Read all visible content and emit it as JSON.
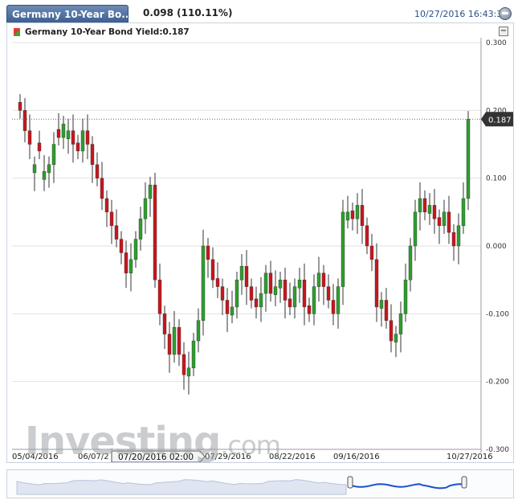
{
  "header": {
    "tab_title": "Germany 10-Year Bo...",
    "price_change": "0.098 (110.11%)",
    "datetime": "10/27/2016 16:43:38"
  },
  "legend": {
    "label": "Germany 10-Year Bond Yield:0.187"
  },
  "watermark": {
    "main": "Investing",
    "suffix": ".com"
  },
  "cursor_label": "07/20/2016 02:00",
  "colors": {
    "up": "#2e9e2e",
    "down": "#c8161d",
    "grid": "#e2e2e2",
    "accent": "#3e5f91"
  },
  "chart_data": {
    "type": "candlestick",
    "title": "Germany 10-Year Bond Yield",
    "current_value": 0.187,
    "current_label": "0.187",
    "ylim": [
      -0.3,
      0.3
    ],
    "y_ticks": [
      0.3,
      0.2,
      0.1,
      0.0,
      -0.1,
      -0.2,
      -0.3
    ],
    "y_tick_labels": [
      "0.300",
      "0.200",
      "0.100",
      "0.000",
      "-0.100",
      "-0.200",
      "-0.300"
    ],
    "x_ticks": [
      "05/04/2016",
      "06/07/2",
      "07/29/2016",
      "08/22/2016",
      "09/16/2016",
      "10/27/2016"
    ],
    "closes": [
      0.2,
      0.17,
      0.15,
      0.12,
      0.14,
      0.11,
      0.12,
      0.15,
      0.16,
      0.18,
      0.17,
      0.15,
      0.14,
      0.17,
      0.15,
      0.12,
      0.1,
      0.07,
      0.05,
      0.03,
      0.01,
      -0.01,
      -0.04,
      -0.02,
      0.01,
      0.04,
      0.07,
      0.09,
      -0.05,
      -0.1,
      -0.13,
      -0.16,
      -0.12,
      -0.16,
      -0.19,
      -0.18,
      -0.14,
      -0.11,
      0.0,
      -0.02,
      -0.05,
      -0.06,
      -0.08,
      -0.1,
      -0.09,
      -0.05,
      -0.03,
      -0.06,
      -0.08,
      -0.09,
      -0.07,
      -0.04,
      -0.07,
      -0.06,
      -0.05,
      -0.08,
      -0.09,
      -0.06,
      -0.05,
      -0.09,
      -0.1,
      -0.06,
      -0.04,
      -0.06,
      -0.08,
      -0.1,
      -0.06,
      0.05,
      0.05,
      0.04,
      0.06,
      0.03,
      0.0,
      -0.02,
      -0.09,
      -0.08,
      -0.11,
      -0.14,
      -0.13,
      -0.1,
      -0.05,
      0.0,
      0.05,
      0.07,
      0.05,
      0.06,
      0.04,
      0.03,
      0.05,
      0.02,
      0.0,
      0.03,
      0.07,
      0.187
    ],
    "up": [
      0,
      0,
      0,
      1,
      0,
      1,
      1,
      1,
      0,
      1,
      1,
      0,
      0,
      1,
      0,
      0,
      0,
      0,
      0,
      0,
      0,
      0,
      0,
      1,
      1,
      1,
      1,
      1,
      0,
      0,
      0,
      0,
      1,
      0,
      0,
      1,
      1,
      1,
      1,
      0,
      0,
      0,
      0,
      0,
      1,
      1,
      1,
      0,
      0,
      0,
      1,
      1,
      0,
      1,
      1,
      0,
      0,
      1,
      1,
      0,
      0,
      1,
      1,
      0,
      0,
      0,
      1,
      1,
      1,
      0,
      1,
      0,
      0,
      0,
      0,
      1,
      0,
      0,
      1,
      1,
      1,
      1,
      1,
      1,
      0,
      1,
      0,
      0,
      1,
      0,
      0,
      1,
      1,
      1
    ]
  }
}
